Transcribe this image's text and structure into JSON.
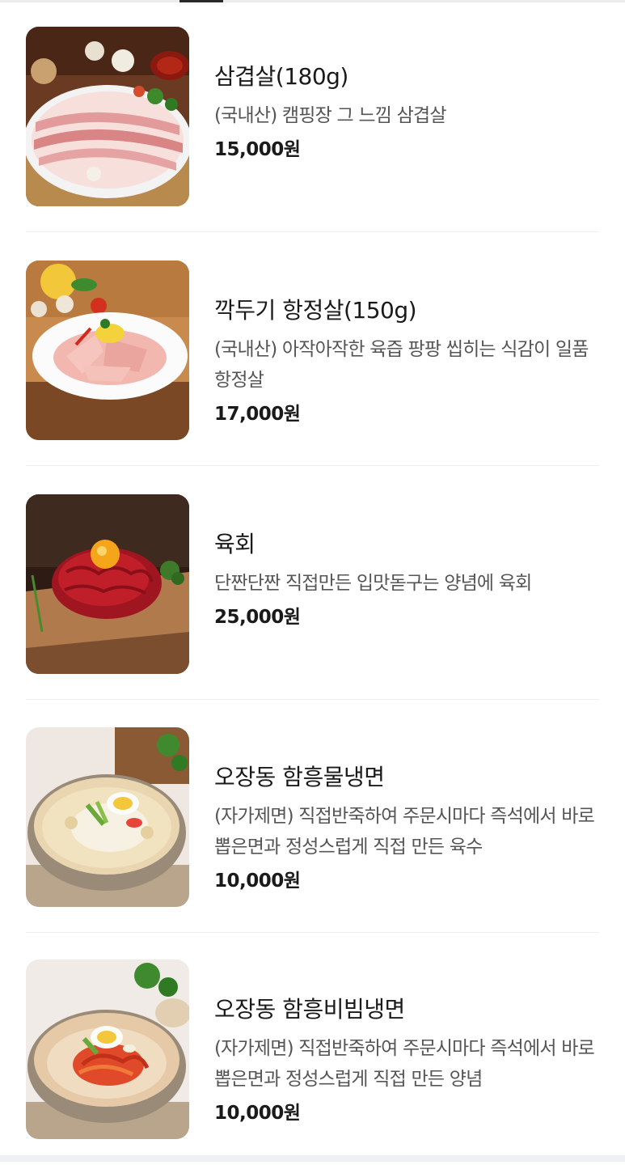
{
  "menu": {
    "items": [
      {
        "name": "삼겹살(180g)",
        "description": "(국내산) 캠핑장 그 느낌 삼겹살",
        "price": "15,000원",
        "image_icon": "pork-belly-photo"
      },
      {
        "name": "깍두기 항정살(150g)",
        "description": "(국내산) 아작아작한 육즙 팡팡 씹히는 식감이 일품 항정살",
        "price": "17,000원",
        "image_icon": "pork-jowl-photo"
      },
      {
        "name": "육회",
        "description": "단짠단짠 직접만든 입맛돋구는 양념에 육회",
        "price": "25,000원",
        "image_icon": "beef-tartare-photo"
      },
      {
        "name": "오장동 함흥물냉면",
        "description": "(자가제면) 직접반죽하여 주문시마다 즉석에서 바로 뽑은면과 정성스럽게 직접 만든 육수",
        "price": "10,000원",
        "image_icon": "cold-noodle-soup-photo"
      },
      {
        "name": "오장동 함흥비빔냉면",
        "description": "(자가제면) 직접반죽하여 주문시마다 즉석에서 바로 뽑은면과 정성스럽게 직접 만든 양념",
        "price": "10,000원",
        "image_icon": "spicy-cold-noodle-photo"
      }
    ]
  }
}
